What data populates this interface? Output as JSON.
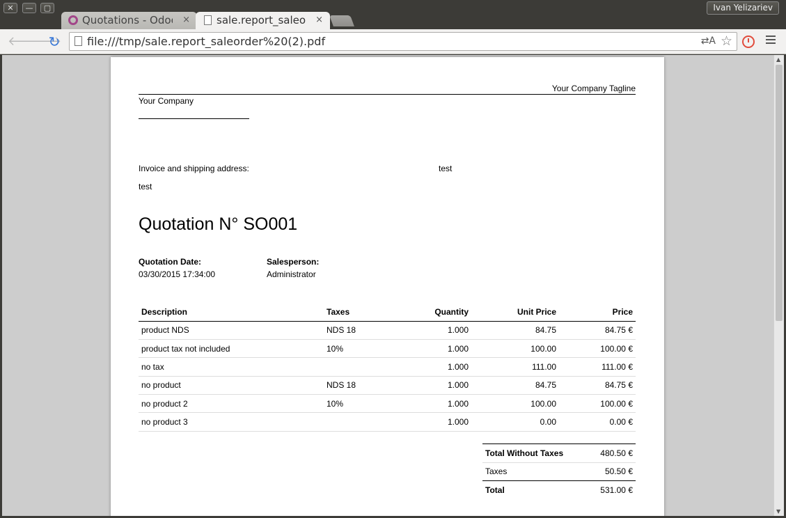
{
  "window": {
    "user": "Ivan Yelizariev",
    "controls": {
      "close": "✕",
      "minimize": "—",
      "maximize": "▢"
    }
  },
  "tabs": [
    {
      "label": "Quotations - Odoo",
      "icon": "odoo-icon",
      "close": "×",
      "active": false
    },
    {
      "label": "sale.report_saleorder",
      "icon": "page-icon",
      "close": "×",
      "active": true
    }
  ],
  "toolbar": {
    "url": "file:///tmp/sale.report_saleorder%20(2).pdf",
    "back": "🡐",
    "forward": "🡒",
    "reload": "↻",
    "translate": "⇄A",
    "star": "☆"
  },
  "document": {
    "tagline": "Your Company Tagline",
    "company": "Your Company",
    "address_label": "Invoice and shipping address:",
    "address_name": "test",
    "address_right": "test",
    "title": "Quotation N° SO001",
    "quotation_date_label": "Quotation Date:",
    "quotation_date": "03/30/2015 17:34:00",
    "salesperson_label": "Salesperson:",
    "salesperson": "Administrator",
    "columns": [
      "Description",
      "Taxes",
      "Quantity",
      "Unit Price",
      "Price"
    ],
    "rows": [
      [
        "product NDS",
        "NDS 18",
        "1.000",
        "84.75",
        "84.75 €"
      ],
      [
        "product tax not included",
        "10%",
        "1.000",
        "100.00",
        "100.00 €"
      ],
      [
        "no tax",
        "",
        "1.000",
        "111.00",
        "111.00 €"
      ],
      [
        "no product",
        "NDS 18",
        "1.000",
        "84.75",
        "84.75 €"
      ],
      [
        "no product 2",
        "10%",
        "1.000",
        "100.00",
        "100.00 €"
      ],
      [
        "no product 3",
        "",
        "1.000",
        "0.00",
        "0.00 €"
      ]
    ],
    "totals": [
      {
        "label": "Total Without Taxes",
        "value": "480.50 €"
      },
      {
        "label": "Taxes",
        "value": "50.50 €"
      },
      {
        "label": "Total",
        "value": "531.00 €"
      }
    ]
  }
}
